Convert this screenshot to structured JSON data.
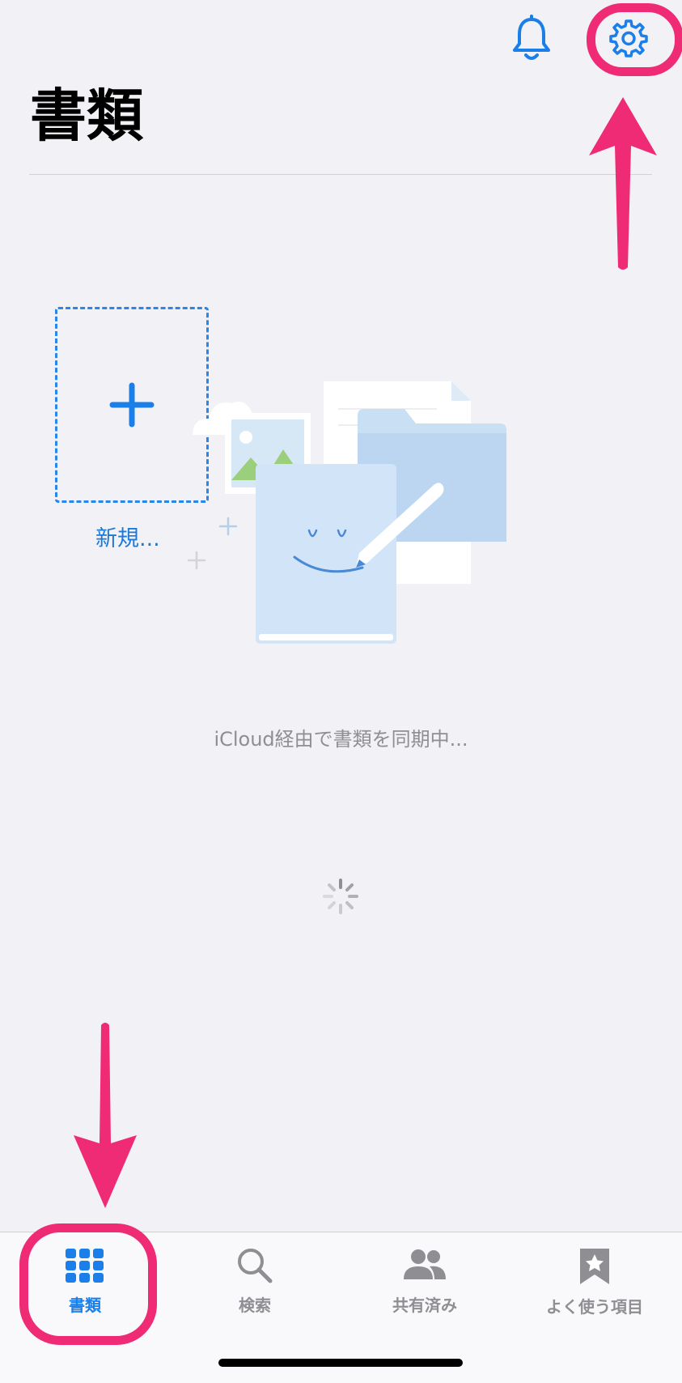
{
  "header": {
    "title": "書類",
    "bell_icon": "bell-icon",
    "settings_icon": "gear-icon"
  },
  "new_document": {
    "label": "新規..."
  },
  "status": {
    "sync_text": "iCloud経由で書類を同期中..."
  },
  "tabs": [
    {
      "label": "書類",
      "icon": "grid-icon",
      "active": true
    },
    {
      "label": "検索",
      "icon": "search-icon",
      "active": false
    },
    {
      "label": "共有済み",
      "icon": "people-icon",
      "active": false
    },
    {
      "label": "よく使う項目",
      "icon": "bookmark-star-icon",
      "active": false
    }
  ],
  "colors": {
    "accent": "#1a7fe8",
    "inactive": "#8e8e93",
    "highlight": "#ee2b74",
    "background": "#f2f1f6"
  }
}
